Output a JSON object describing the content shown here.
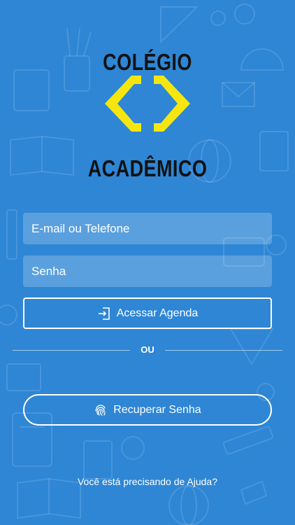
{
  "brand": {
    "line1": "COLÉGIO",
    "line2": "ACADÊMICO",
    "emblem_color": "#f5e60f"
  },
  "form": {
    "email_placeholder": "E-mail ou Telefone",
    "password_placeholder": "Senha",
    "login_label": "Acessar Agenda",
    "login_icon": "sign-in-icon"
  },
  "divider": {
    "label": "OU"
  },
  "recover": {
    "label": "Recuperar Senha",
    "icon": "fingerprint-icon"
  },
  "help": {
    "label": "Você está precisando de Ajuda?"
  },
  "theme": {
    "background": "#2e86d5",
    "text": "#ffffff",
    "brand_text": "#121212"
  }
}
